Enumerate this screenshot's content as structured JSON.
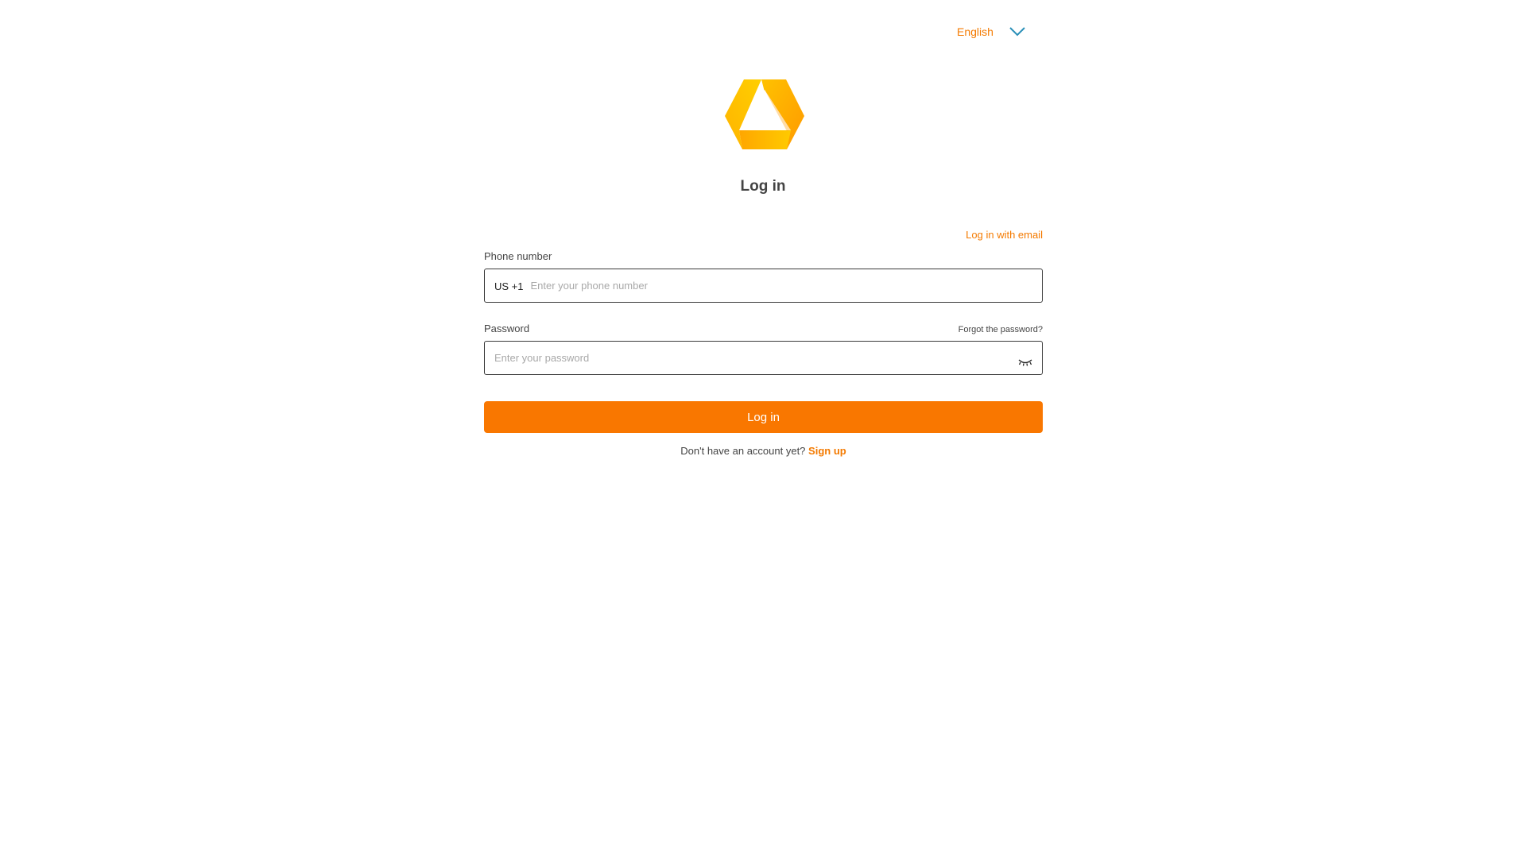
{
  "language": {
    "selected": "English",
    "chevron_icon": "chevron-down-icon",
    "chevron_color": "#2a8fb8"
  },
  "logo": {
    "icon": "brand-logo-icon",
    "colors": [
      "#ffc000",
      "#f7a800",
      "#ff8c00"
    ]
  },
  "title": "Log in",
  "login_with_email": "Log in with email",
  "phone": {
    "label": "Phone number",
    "country_code": "US +1",
    "placeholder": "Enter your phone number",
    "value": ""
  },
  "password": {
    "label": "Password",
    "forgot_label": "Forgot the password?",
    "placeholder": "Enter your password",
    "value": "",
    "toggle_icon": "eye-closed-icon"
  },
  "login_button": "Log in",
  "signup": {
    "prompt": "Don't have an account yet?",
    "link": "Sign up"
  },
  "colors": {
    "accent": "#f97700",
    "link": "#f47a00",
    "background": "#ffffff"
  }
}
